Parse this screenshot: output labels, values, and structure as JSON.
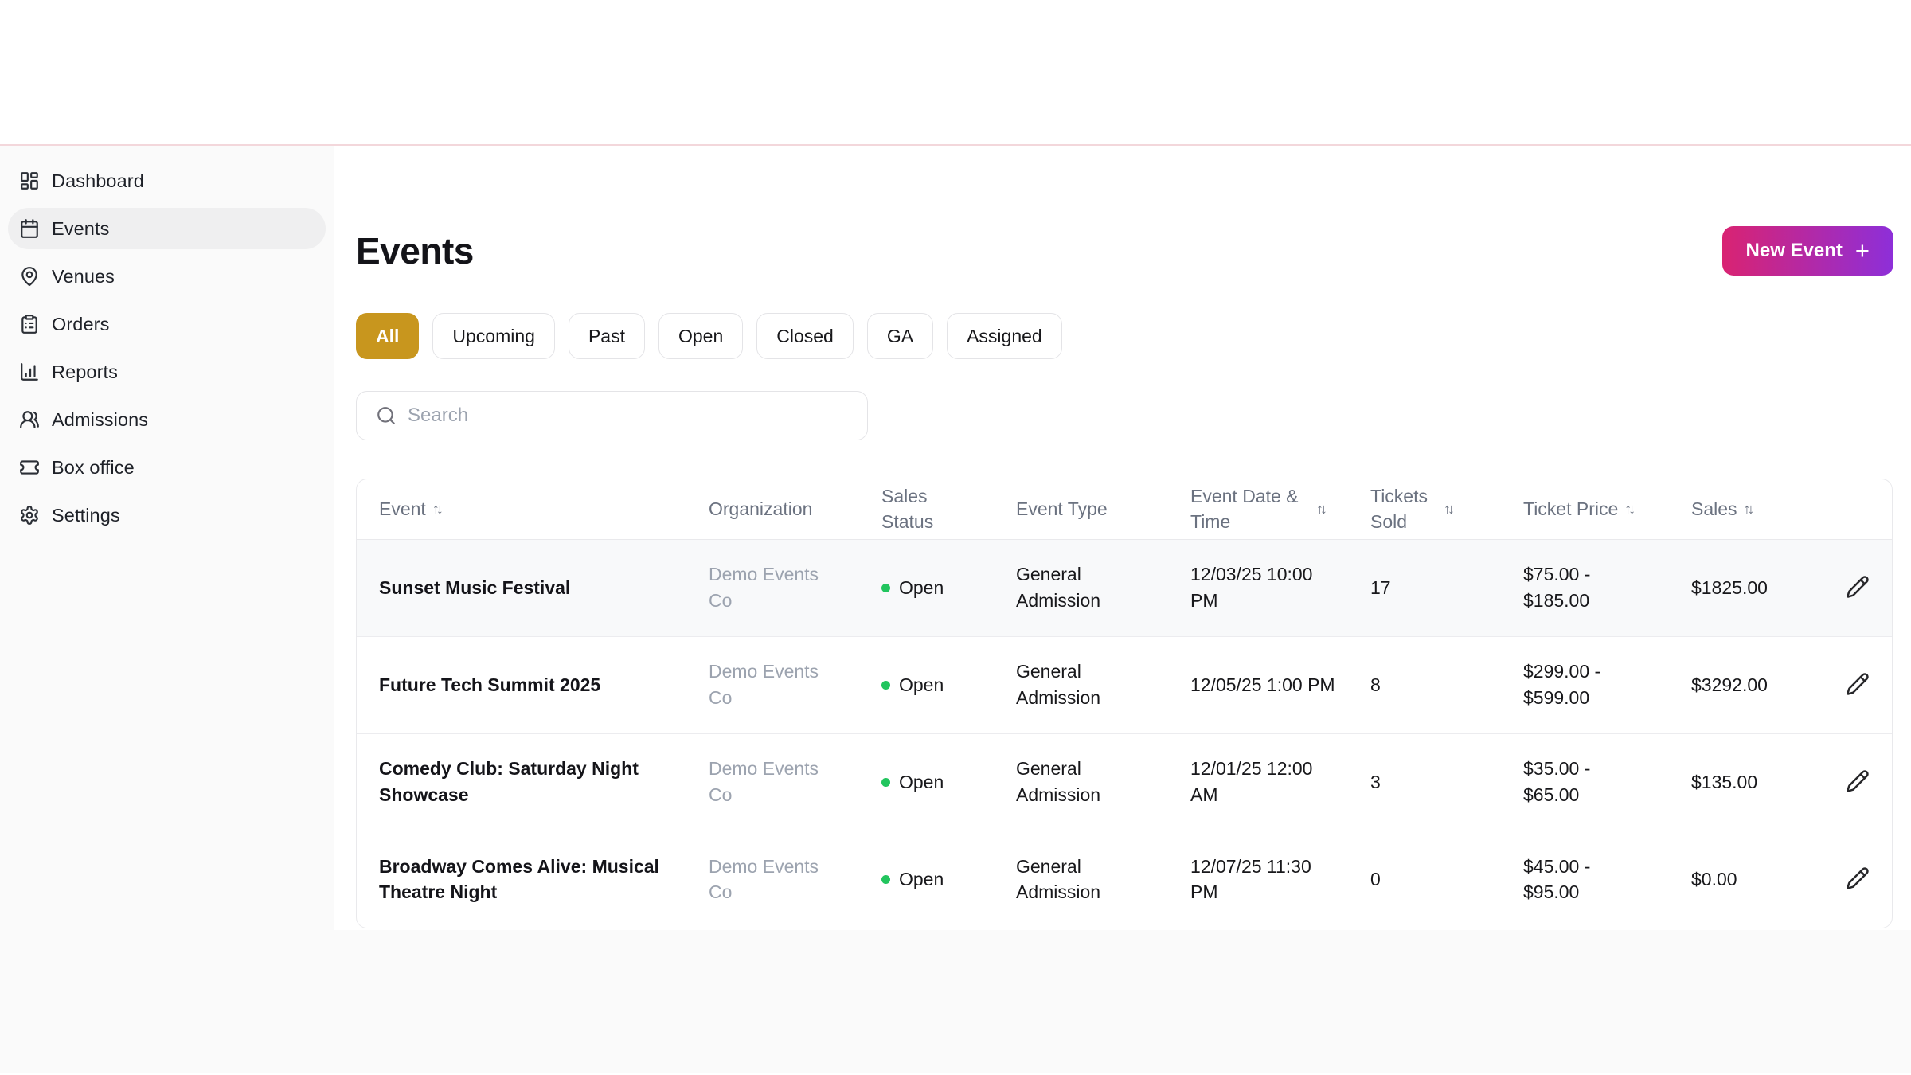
{
  "header": {
    "title": "Events",
    "new_event_label": "New Event",
    "plus_glyph": "+"
  },
  "sidebar": {
    "items": [
      {
        "label": "Dashboard",
        "icon": "dashboard-grid"
      },
      {
        "label": "Events",
        "icon": "calendar",
        "active": true
      },
      {
        "label": "Venues",
        "icon": "map-pin"
      },
      {
        "label": "Orders",
        "icon": "clipboard-list"
      },
      {
        "label": "Reports",
        "icon": "bar-chart"
      },
      {
        "label": "Admissions",
        "icon": "users"
      },
      {
        "label": "Box office",
        "icon": "ticket"
      },
      {
        "label": "Settings",
        "icon": "gear"
      }
    ]
  },
  "filters": [
    {
      "label": "All",
      "active": true
    },
    {
      "label": "Upcoming",
      "active": false
    },
    {
      "label": "Past",
      "active": false
    },
    {
      "label": "Open",
      "active": false
    },
    {
      "label": "Closed",
      "active": false
    },
    {
      "label": "GA",
      "active": false
    },
    {
      "label": "Assigned",
      "active": false
    }
  ],
  "search": {
    "placeholder": "Search"
  },
  "table": {
    "sort_glyph": "↑↓",
    "columns": [
      {
        "label": "Event",
        "sortable": true
      },
      {
        "label": "Organization",
        "sortable": false
      },
      {
        "label": "Sales Status",
        "sortable": false
      },
      {
        "label": "Event Type",
        "sortable": false
      },
      {
        "label": "Event Date & Time",
        "sortable": true
      },
      {
        "label": "Tickets Sold",
        "sortable": true
      },
      {
        "label": "Ticket Price",
        "sortable": true
      },
      {
        "label": "Sales",
        "sortable": true
      },
      {
        "label": "",
        "sortable": false
      }
    ],
    "rows": [
      {
        "event": "Sunset Music Festival",
        "organization": "Demo Events Co",
        "sales_status": "Open",
        "event_type": "General Admission",
        "date_time": "12/03/25 10:00 PM",
        "tickets_sold": "17",
        "ticket_price": "$75.00 - $185.00",
        "sales": "$1825.00"
      },
      {
        "event": "Future Tech Summit 2025",
        "organization": "Demo Events Co",
        "sales_status": "Open",
        "event_type": "General Admission",
        "date_time": "12/05/25 1:00 PM",
        "tickets_sold": "8",
        "ticket_price": "$299.00 - $599.00",
        "sales": "$3292.00"
      },
      {
        "event": "Comedy Club: Saturday Night Showcase",
        "organization": "Demo Events Co",
        "sales_status": "Open",
        "event_type": "General Admission",
        "date_time": "12/01/25 12:00 AM",
        "tickets_sold": "3",
        "ticket_price": "$35.00 - $65.00",
        "sales": "$135.00"
      },
      {
        "event": "Broadway Comes Alive: Musical Theatre Night",
        "organization": "Demo Events Co",
        "sales_status": "Open",
        "event_type": "General Admission",
        "date_time": "12/07/25 11:30 PM",
        "tickets_sold": "0",
        "ticket_price": "$45.00 - $95.00",
        "sales": "$0.00"
      }
    ]
  },
  "colors": {
    "accent_pink": "#d92372",
    "accent_purple": "#8d2fd9",
    "chip_active_bg": "#c8961e",
    "status_open": "#22c55e",
    "top_border": "#f3d7db",
    "sidebar_bg": "#fafafa"
  }
}
